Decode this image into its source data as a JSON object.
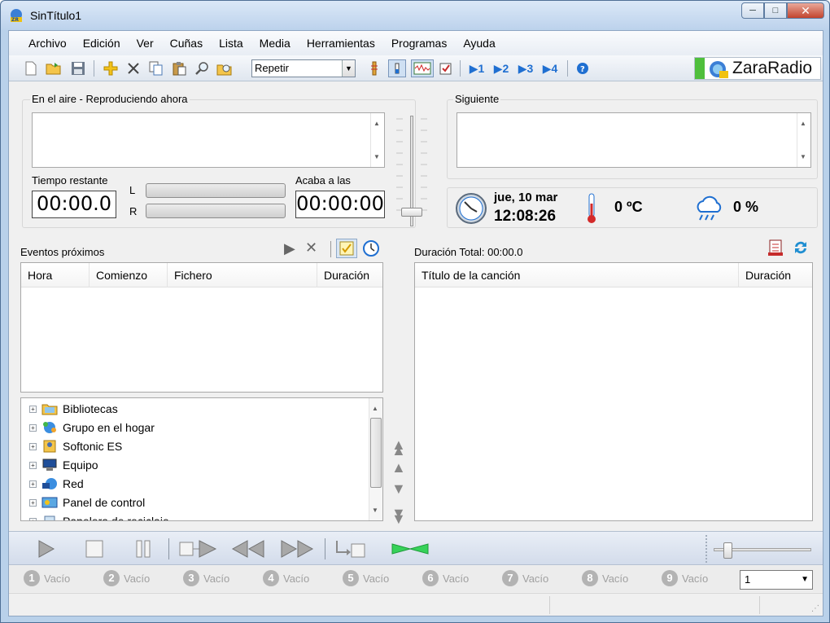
{
  "window": {
    "title": "SinTítulo1"
  },
  "menu": [
    "Archivo",
    "Edición",
    "Ver",
    "Cuñas",
    "Lista",
    "Media",
    "Herramientas",
    "Programas",
    "Ayuda"
  ],
  "toolbar": {
    "repeat_value": "Repetir",
    "brand": "ZaraRadio"
  },
  "on_air": {
    "title": "En el aire - Reproduciendo ahora",
    "remaining_label": "Tiempo restante",
    "remaining_value": "00:00.0",
    "ends_label": "Acaba a las",
    "ends_value": "00:00:00",
    "left_channel": "L",
    "right_channel": "R",
    "volume_level": 0.1
  },
  "next": {
    "title": "Siguiente"
  },
  "info": {
    "date": "jue, 10 mar",
    "time": "12:08:26",
    "temperature": "0 ºC",
    "rain": "0 %"
  },
  "events": {
    "title": "Eventos próximos",
    "columns": [
      "Hora",
      "Comienzo",
      "Fichero",
      "Duración"
    ]
  },
  "playlist": {
    "total": "Duración Total: 00:00.0",
    "columns": [
      "Título de la canción",
      "Duración"
    ]
  },
  "tree": [
    "Bibliotecas",
    "Grupo en el hogar",
    "Softonic ES",
    "Equipo",
    "Red",
    "Panel de control",
    "Papelera de reciclaje"
  ],
  "carts": [
    {
      "num": "1",
      "label": "Vacío"
    },
    {
      "num": "2",
      "label": "Vacío"
    },
    {
      "num": "3",
      "label": "Vacío"
    },
    {
      "num": "4",
      "label": "Vacío"
    },
    {
      "num": "5",
      "label": "Vacío"
    },
    {
      "num": "6",
      "label": "Vacío"
    },
    {
      "num": "7",
      "label": "Vacío"
    },
    {
      "num": "8",
      "label": "Vacío"
    },
    {
      "num": "9",
      "label": "Vacío"
    }
  ],
  "cart_page": "1",
  "colors": {
    "accent_green": "#46c346",
    "thermo_red": "#d32a2a",
    "icon_blue": "#1f6fd1"
  }
}
